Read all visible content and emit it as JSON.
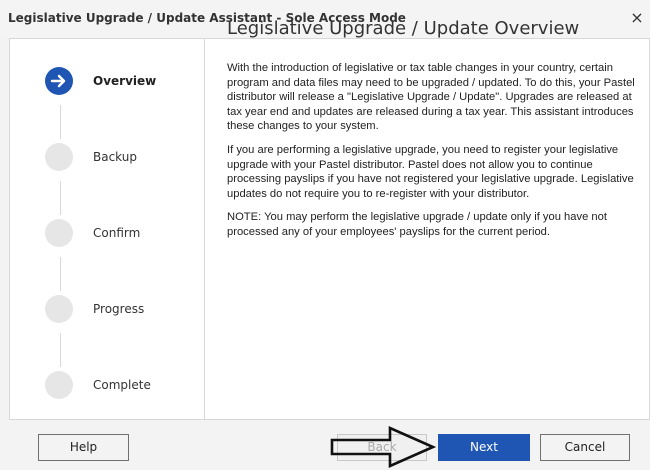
{
  "window": {
    "title": "Legislative Upgrade / Update Assistant - Sole Access Mode",
    "close_symbol": "×"
  },
  "steps": [
    {
      "label": "Overview",
      "state": "active"
    },
    {
      "label": "Backup",
      "state": "pending"
    },
    {
      "label": "Confirm",
      "state": "pending"
    },
    {
      "label": "Progress",
      "state": "pending"
    },
    {
      "label": "Complete",
      "state": "pending"
    }
  ],
  "content": {
    "heading": "Legislative Upgrade / Update Overview",
    "paragraphs": [
      "With the introduction of legislative or tax table changes in your country, certain program and data files may need to be upgraded / updated. To do this, your Pastel distributor will release a \"Legislative Upgrade / Update\". Upgrades are released at tax year end and updates are released during a tax year. This assistant introduces these changes to your system.",
      "If you are performing a legislative upgrade, you need to register your legislative upgrade with your Pastel distributor. Pastel does not allow you to continue processing payslips if you have not registered your legislative upgrade. Legislative updates do not require you to re-register with your distributor.",
      "NOTE: You may perform the legislative upgrade / update only if you have not processed any of your employees' payslips for the current period."
    ]
  },
  "footer": {
    "help_label": "Help",
    "back_label": "Back",
    "next_label": "Next",
    "cancel_label": "Cancel"
  },
  "colors": {
    "accent": "#1f56b4",
    "inactive_step": "#e6e6e6"
  },
  "icons": {
    "active_step": "arrow-right-icon",
    "close": "close-icon",
    "annotation": "pointer-arrow-icon"
  }
}
